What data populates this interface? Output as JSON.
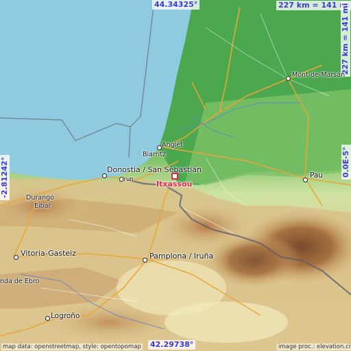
{
  "map": {
    "target": "Itxassou",
    "coords": {
      "top": "44.34325°",
      "bottom": "42.29738°",
      "left": "-2.81242°",
      "right": "0.0E-5°"
    },
    "scale": {
      "horizontal": "227 km = 141 mi",
      "vertical": "227 km = 141 mi"
    },
    "cities": [
      {
        "name": "Mont-de-Marsan"
      },
      {
        "name": "Anglet"
      },
      {
        "name": "Biarritz"
      },
      {
        "name": "Donostia / San Sebastián"
      },
      {
        "name": "Irun"
      },
      {
        "name": "Pau"
      },
      {
        "name": "Durango"
      },
      {
        "name": "Eibar"
      },
      {
        "name": "Vitoria-Gasteiz"
      },
      {
        "name": "Pamplona / Iruña"
      },
      {
        "name": "nda de Ebro"
      },
      {
        "name": "Logroño"
      }
    ],
    "attribution": {
      "left": "map data: openstreetmap, style: opentopomap",
      "right": "image proc.: elevation.city"
    },
    "colors": {
      "sea": "#8fcbe0",
      "lowland": "#56b356",
      "hills": "#cfe3a5",
      "mountains": "#a0673f",
      "target": "#e0283c",
      "coords": "#3b3bd1"
    }
  }
}
